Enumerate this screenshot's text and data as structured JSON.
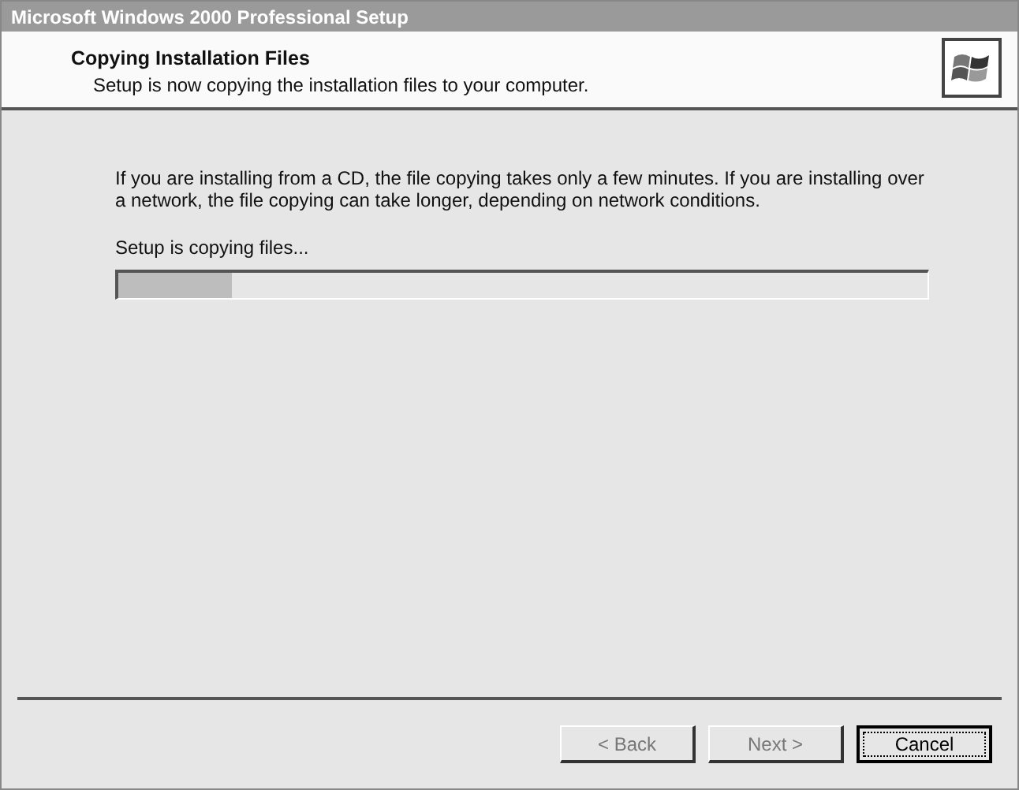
{
  "window": {
    "title": "Microsoft Windows 2000 Professional Setup"
  },
  "header": {
    "title": "Copying Installation Files",
    "subtitle": "Setup is now copying the installation files to your computer."
  },
  "body": {
    "description": "If you are installing from a CD, the file copying takes only a few minutes.  If you are installing over a network, the file copying can take longer, depending on network conditions.",
    "status": "Setup is copying files...",
    "progress": {
      "level": 0.14
    }
  },
  "buttons": [
    {
      "label": "< Back",
      "disabled": true,
      "focused": false
    },
    {
      "label": "Next >",
      "disabled": true,
      "focused": false
    },
    {
      "label": "Cancel",
      "disabled": false,
      "focused": true
    }
  ]
}
